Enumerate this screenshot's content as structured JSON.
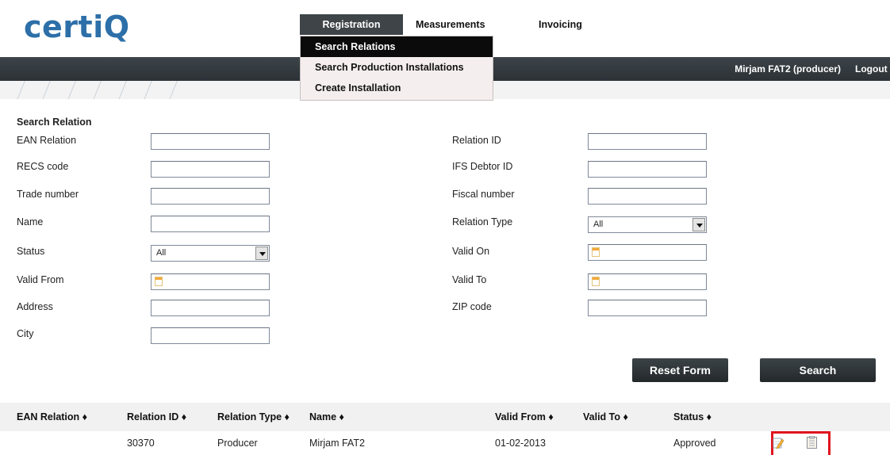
{
  "logo": "certiQ",
  "nav": {
    "registration": "Registration",
    "measurements": "Measurements",
    "invoicing": "Invoicing"
  },
  "dropdown": {
    "items": [
      "Search Relations",
      "Search Production Installations",
      "Create Installation"
    ]
  },
  "user": {
    "name": "Mirjam FAT2 (producer)",
    "logout": "Logout"
  },
  "form": {
    "title": "Search Relation",
    "left": {
      "ean_relation": "EAN Relation",
      "recs_code": "RECS code",
      "trade_number": "Trade number",
      "name": "Name",
      "status": "Status",
      "status_value": "All",
      "valid_from": "Valid From",
      "address": "Address",
      "city": "City"
    },
    "right": {
      "relation_id": "Relation ID",
      "ifs_debtor_id": "IFS Debtor ID",
      "fiscal_number": "Fiscal number",
      "relation_type": "Relation Type",
      "relation_type_value": "All",
      "valid_on": "Valid On",
      "valid_to": "Valid To",
      "zip_code": "ZIP code"
    },
    "reset_label": "Reset Form",
    "search_label": "Search"
  },
  "table": {
    "headers": [
      "EAN Relation ♦",
      "Relation ID ♦",
      "Relation Type ♦",
      "Name ♦",
      "Valid From ♦",
      "Valid To ♦",
      "Status ♦"
    ],
    "rows": [
      {
        "ean_relation": "",
        "relation_id": "30370",
        "relation_type": "Producer",
        "name": "Mirjam FAT2",
        "valid_from": "01-02-2013",
        "valid_to": "",
        "status": "Approved"
      }
    ]
  },
  "icons": {
    "edit": "edit-icon",
    "clipboard": "clipboard-icon",
    "calendar": "calendar-icon",
    "dropdown_arrow": "chevron-down-icon"
  },
  "colors": {
    "brand": "#2d6fa8",
    "dark_bar": "#353b3f",
    "highlight": "#e0141e"
  }
}
